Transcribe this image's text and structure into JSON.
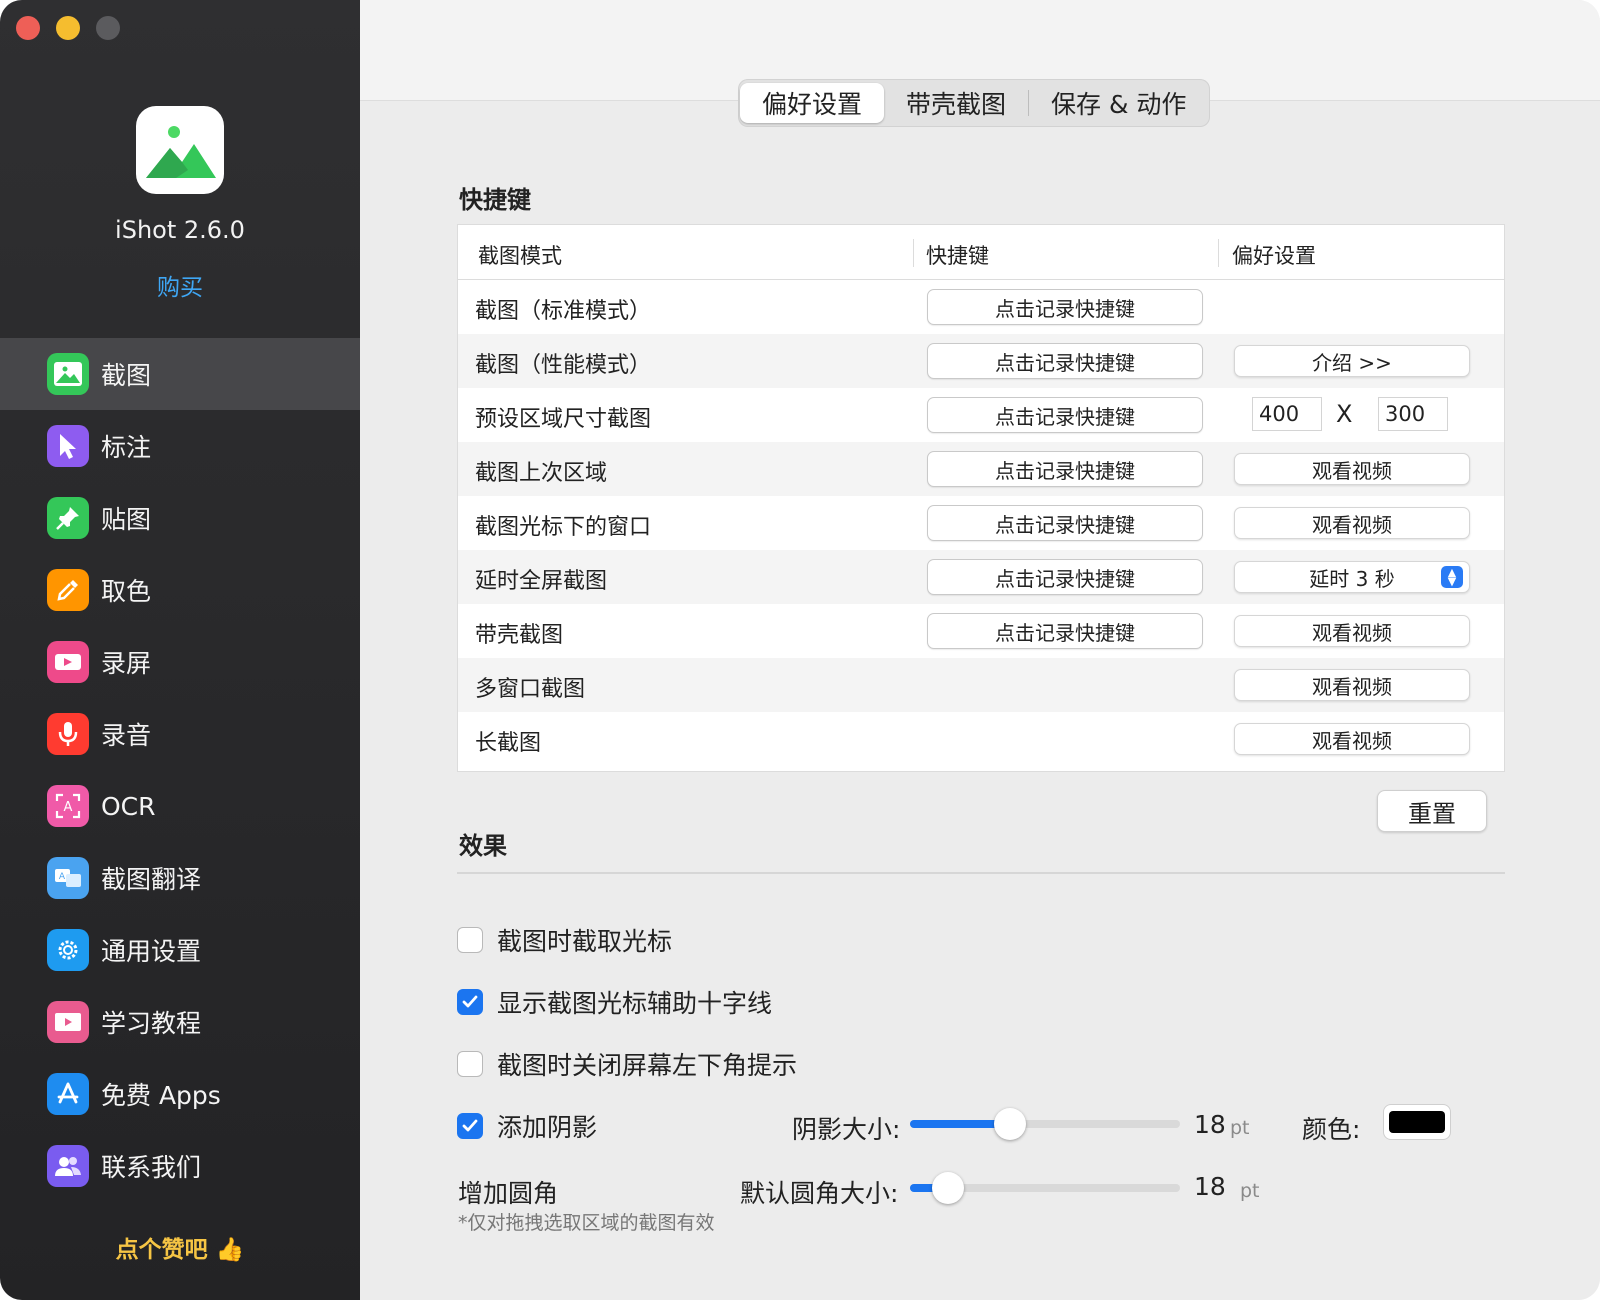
{
  "sidebar": {
    "app_name": "iShot 2.6.0",
    "buy_label": "购买",
    "like_label": "点个赞吧 👍",
    "items": [
      {
        "label": "截图",
        "icon": "screenshot-icon",
        "color": "#34c759"
      },
      {
        "label": "标注",
        "icon": "cursor-icon",
        "color": "#8e5cf0"
      },
      {
        "label": "贴图",
        "icon": "pin-icon",
        "color": "#34c759"
      },
      {
        "label": "取色",
        "icon": "eyedropper-icon",
        "color": "#ff9500"
      },
      {
        "label": "录屏",
        "icon": "video-camera-icon",
        "color": "#ee4a8a"
      },
      {
        "label": "录音",
        "icon": "microphone-icon",
        "color": "#ff3b30"
      },
      {
        "label": "OCR",
        "icon": "ocr-icon",
        "color": "#f05aa8"
      },
      {
        "label": "截图翻译",
        "icon": "translate-icon",
        "color": "#4aa3f0"
      },
      {
        "label": "通用设置",
        "icon": "gear-icon",
        "color": "#1e9bf0"
      },
      {
        "label": "学习教程",
        "icon": "tutorial-icon",
        "color": "#e95b8f"
      },
      {
        "label": "免费 Apps",
        "icon": "app-store-icon",
        "color": "#1e8cf0"
      },
      {
        "label": "联系我们",
        "icon": "contacts-icon",
        "color": "#7a5cf0"
      }
    ]
  },
  "tabs": [
    "偏好设置",
    "带壳截图",
    "保存 & 动作"
  ],
  "shortcuts": {
    "title": "快捷键",
    "headers": [
      "截图模式",
      "快捷键",
      "偏好设置"
    ],
    "rows": [
      {
        "mode": "截图（标准模式）",
        "shortcut": "点击记录快捷键",
        "pref": ""
      },
      {
        "mode": "截图（性能模式）",
        "shortcut": "点击记录快捷键",
        "pref": "介绍 >>"
      },
      {
        "mode": "预设区域尺寸截图",
        "shortcut": "点击记录快捷键",
        "pref": ""
      },
      {
        "mode": "截图上次区域",
        "shortcut": "点击记录快捷键",
        "pref": "观看视频"
      },
      {
        "mode": "截图光标下的窗口",
        "shortcut": "点击记录快捷键",
        "pref": "观看视频"
      },
      {
        "mode": "延时全屏截图",
        "shortcut": "点击记录快捷键",
        "pref": "延时 3 秒"
      },
      {
        "mode": "带壳截图",
        "shortcut": "点击记录快捷键",
        "pref": "观看视频"
      },
      {
        "mode": "多窗口截图",
        "shortcut": "",
        "pref": "观看视频"
      },
      {
        "mode": "长截图",
        "shortcut": "",
        "pref": "观看视频"
      }
    ],
    "preset_width": "400",
    "preset_x": "X",
    "preset_height": "300",
    "reset_label": "重置"
  },
  "effects": {
    "title": "效果",
    "capture_cursor": {
      "label": "截图时截取光标",
      "checked": false
    },
    "show_crosshair": {
      "label": "显示截图光标辅助十字线",
      "checked": true
    },
    "close_hint": {
      "label": "截图时关闭屏幕左下角提示",
      "checked": false
    },
    "shadow": {
      "label": "添加阴影",
      "checked": true
    },
    "shadow_size_label": "阴影大小:",
    "shadow_size_value": "18",
    "shadow_size_fraction": 0.37,
    "shadow_unit": "pt",
    "color_label": "颜色:",
    "shadow_color": "#000000",
    "corner_label": "增加圆角",
    "corner_size_label": "默认圆角大小:",
    "corner_size_value": "18",
    "corner_size_fraction": 0.14,
    "corner_unit": "pt",
    "note": "*仅对拖拽选取区域的截图有效"
  },
  "colors": {
    "accent": "#1b75f0",
    "link": "#3fa7f5",
    "like": "#f6c544"
  }
}
